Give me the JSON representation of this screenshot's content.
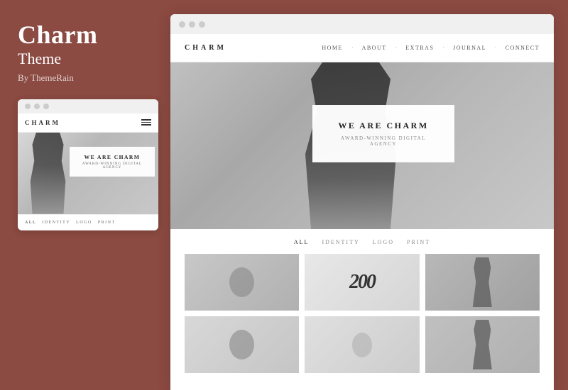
{
  "left_panel": {
    "title": "Charm",
    "subtitle": "Theme",
    "author": "By ThemeRain"
  },
  "mobile_preview": {
    "titlebar_dots": [
      "dot1",
      "dot2",
      "dot3"
    ],
    "logo": "CHARM",
    "hero_main": "WE ARE CHARM",
    "hero_sub": "AWARD-WINNING DIGITAL AGENCY",
    "filter_items": [
      "ALL",
      "IDENTITY",
      "LOGO",
      "PRINT"
    ],
    "active_filter": "ALL"
  },
  "desktop_preview": {
    "titlebar_dots": [
      "dot1",
      "dot2",
      "dot3"
    ],
    "logo": "CHARM",
    "nav_links": [
      "HOME",
      "ABOUT",
      "EXTRAS",
      "JOURNAL",
      "CONNECT"
    ],
    "hero_main": "WE ARE CHARM",
    "hero_sub": "AWARD-WINNING DIGITAL AGENCY",
    "portfolio_filters": [
      "ALL",
      "IDENTITY",
      "LOGO",
      "PRINT"
    ],
    "active_filter": "ALL"
  }
}
